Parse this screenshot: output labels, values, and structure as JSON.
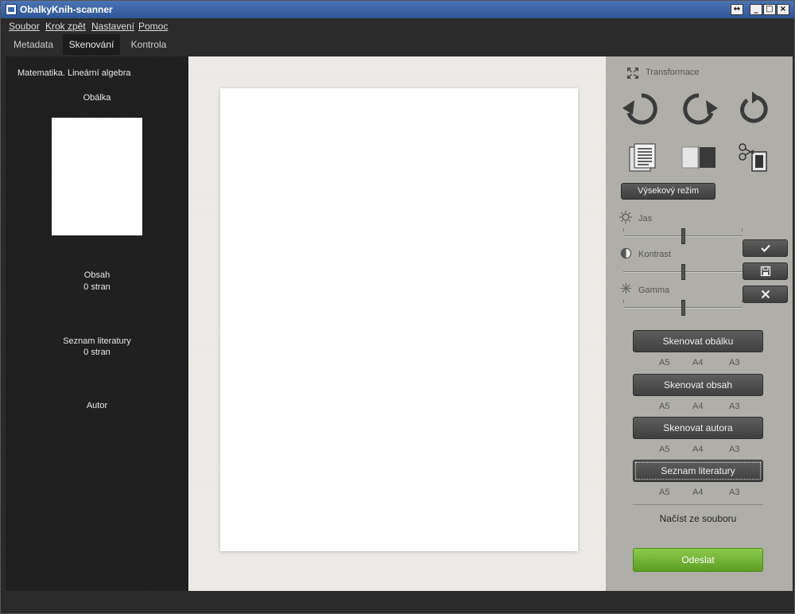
{
  "window": {
    "title": "ObalkyKnih-scanner"
  },
  "menu": {
    "items": [
      {
        "label": "Soubor"
      },
      {
        "label": "Krok zpět"
      },
      {
        "label": "Nastavení"
      },
      {
        "label": "Pomoc"
      }
    ]
  },
  "tabs": [
    {
      "label": "Metadata",
      "active": false
    },
    {
      "label": "Skenování",
      "active": true
    },
    {
      "label": "Kontrola",
      "active": false
    }
  ],
  "left": {
    "book_title": "Matematika. Lineární algebra",
    "cover_label": "Obálka",
    "toc_label": "Obsah",
    "toc_pages": "0 stran",
    "bib_label": "Seznam literatury",
    "bib_pages": "0 stran",
    "author_label": "Autor"
  },
  "right": {
    "transform_label": "Transformace",
    "crop_mode_label": "Výsekový režim",
    "brightness_label": "Jas",
    "contrast_label": "Kontrast",
    "gamma_label": "Gamma",
    "brightness_value": 0.5,
    "contrast_value": 0.5,
    "gamma_value": 0.5,
    "scan_buttons": [
      {
        "label": "Skenovat obálku",
        "sizes": [
          "A5",
          "A4",
          "A3"
        ]
      },
      {
        "label": "Skenovat obsah",
        "sizes": [
          "A5",
          "A4",
          "A3"
        ]
      },
      {
        "label": "Skenovat autora",
        "sizes": [
          "A5",
          "A4",
          "A3"
        ]
      },
      {
        "label": "Seznam literatury",
        "sizes": [
          "A5",
          "A4",
          "A3"
        ]
      }
    ],
    "load_from_file_label": "Načíst ze souboru",
    "send_label": "Odeslat"
  },
  "icons": {
    "transform": "expand-arrows-icon",
    "rotate_left": "rotate-left-icon",
    "rotate_right": "rotate-right-icon",
    "rotate_full": "rotate-cycle-icon",
    "document": "document-lines-icon",
    "split": "split-page-icon",
    "crop": "scissors-icon",
    "brightness": "sun-icon",
    "contrast": "contrast-icon",
    "gamma": "gamma-star-icon",
    "confirm": "checkmark-icon",
    "save": "floppy-icon",
    "cancel": "close-icon"
  },
  "colors": {
    "send_button": "#6fb432",
    "left_panel": "#1e1e1e",
    "right_panel": "#afaea8",
    "title_bar": "#3a65a8"
  }
}
